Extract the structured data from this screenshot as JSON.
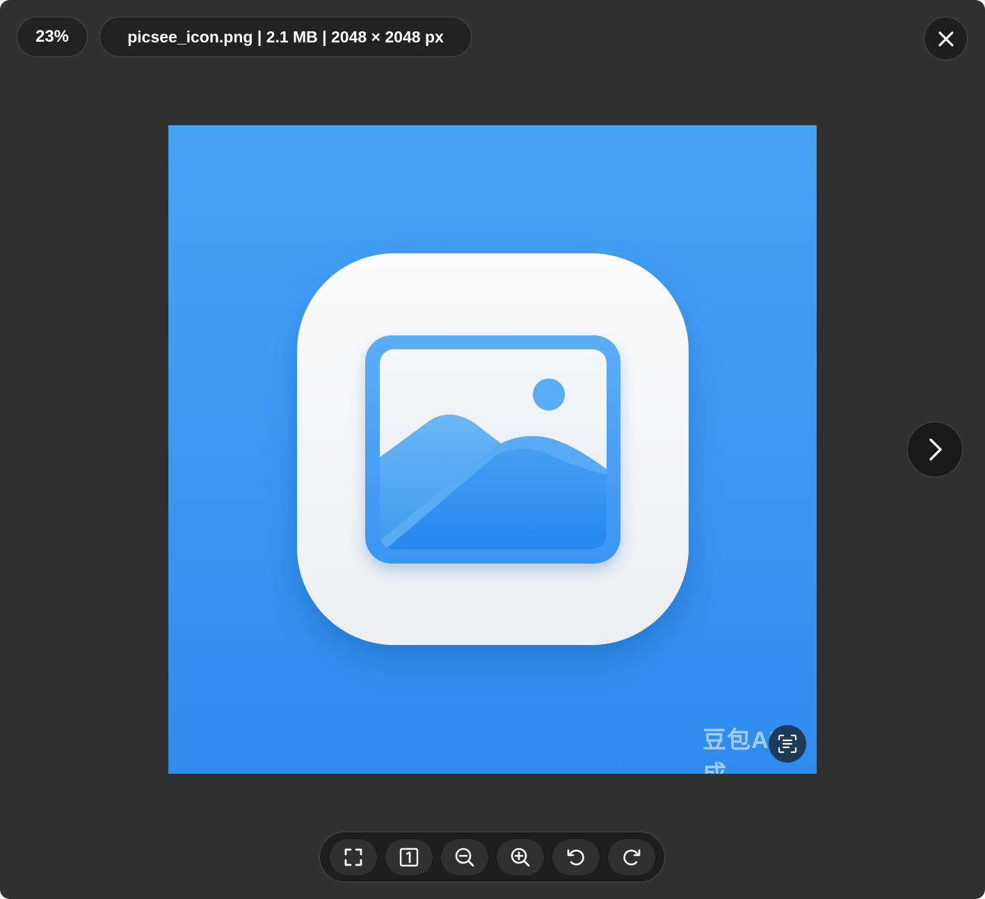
{
  "viewer": {
    "zoom_label": "23%",
    "file_info": "picsee_icon.png | 2.1 MB | 2048 × 2048 px",
    "watermark_text": "豆包AI生成",
    "zoom_percent": 23,
    "colors": {
      "background": "#313131",
      "pill": "#222222",
      "image_blue": "#3d9bf0",
      "icon_white": "#f4f5f7"
    }
  },
  "icons": {
    "close": "close-icon",
    "next": "chevron-right-icon",
    "ocr": "text-scan-icon"
  },
  "toolbar": {
    "buttons": [
      {
        "name": "fullscreen",
        "icon": "fullscreen-icon"
      },
      {
        "name": "actual-size",
        "icon": "one-to-one-icon"
      },
      {
        "name": "zoom-out",
        "icon": "zoom-out-icon"
      },
      {
        "name": "zoom-in",
        "icon": "zoom-in-icon"
      },
      {
        "name": "rotate-left",
        "icon": "rotate-left-icon"
      },
      {
        "name": "rotate-right",
        "icon": "rotate-right-icon"
      }
    ]
  }
}
